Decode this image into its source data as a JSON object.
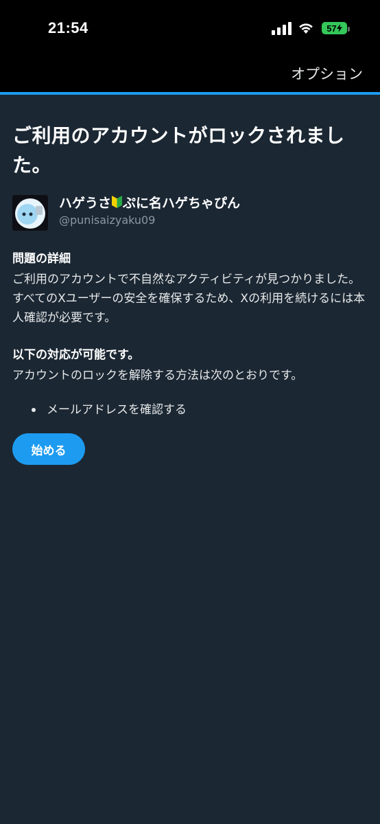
{
  "status_bar": {
    "time": "21:54",
    "battery_level": "57",
    "icons": [
      "signal-icon",
      "wifi-icon",
      "battery-charging-icon"
    ],
    "battery_color": "#34c759"
  },
  "nav": {
    "options_label": "オプション"
  },
  "colors": {
    "background": "#1b2733",
    "accent": "#1d9bf0",
    "secondary_text": "#8b98a5"
  },
  "main": {
    "title": "ご利用のアカウントがロックされました。",
    "account": {
      "display_name_part1": "ハゲうさ",
      "display_name_part2": "ぷに名ハゲちゃぴん",
      "username": "@punisaizyaku09"
    },
    "details": {
      "heading": "問題の詳細",
      "body": "ご利用のアカウントで不自然なアクティビティが見つかりました。すべてのXユーザーの安全を確保するため、Xの利用を続けるには本人確認が必要です。"
    },
    "actions": {
      "heading": "以下の対応が可能です。",
      "body": "アカウントのロックを解除する方法は次のとおりです。",
      "steps": [
        "メールアドレスを確認する"
      ]
    },
    "start_button_label": "始める"
  }
}
